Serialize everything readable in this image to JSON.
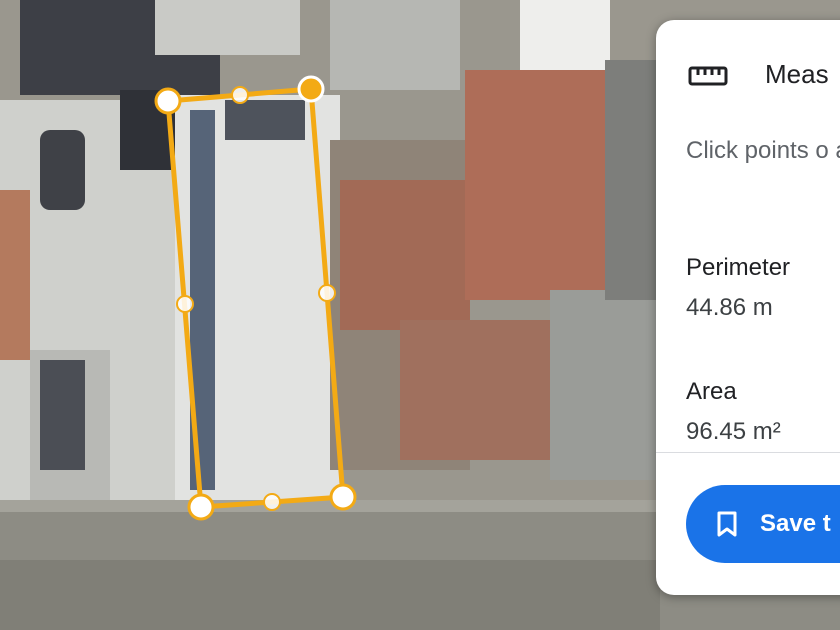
{
  "colors": {
    "measure_line": "#f3aa15",
    "panel_bg": "#ffffff",
    "accent": "#1a73e8",
    "text_primary": "#202124",
    "text_secondary": "#5f6368"
  },
  "panel": {
    "icon": "ruler-icon",
    "title": "Meas",
    "instructions": "Click points o area",
    "perimeter": {
      "label": "Perimeter",
      "value": "44.86 m"
    },
    "area": {
      "label": "Area",
      "value": "96.45 m²"
    },
    "save": {
      "icon": "bookmark-icon",
      "label": "Save t"
    }
  }
}
